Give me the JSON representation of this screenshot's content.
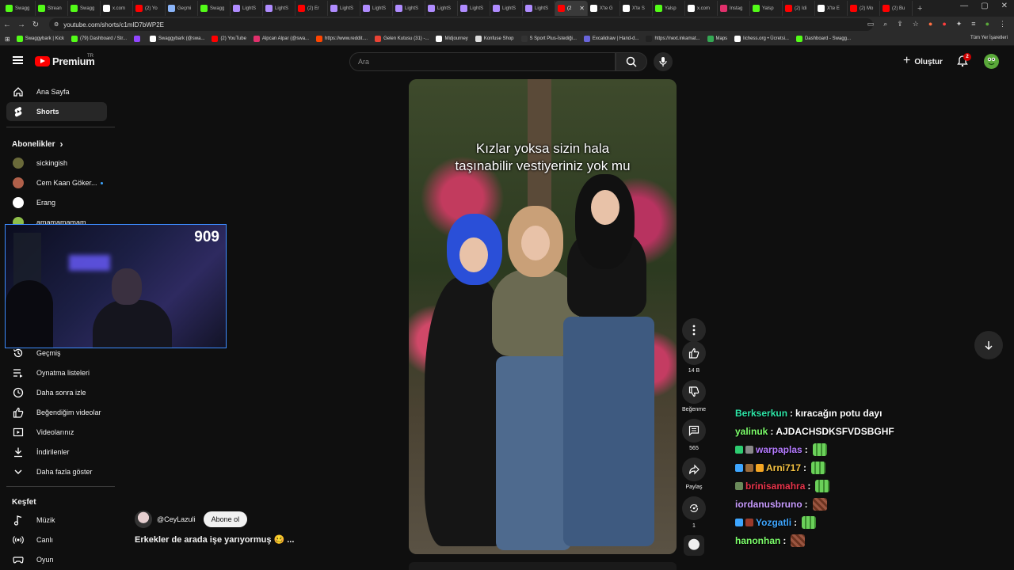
{
  "browser": {
    "tabs": [
      {
        "label": "Swagg",
        "color": "#53fc18"
      },
      {
        "label": "Strean",
        "color": "#53fc18"
      },
      {
        "label": "Swagg",
        "color": "#53fc18"
      },
      {
        "label": "x.com",
        "color": "#ffffff"
      },
      {
        "label": "(2) Yo",
        "color": "#ff0000"
      },
      {
        "label": "Geçmi",
        "color": "#8ab4f8"
      },
      {
        "label": "Swagg",
        "color": "#53fc18"
      },
      {
        "label": "LightS",
        "color": "#b08cff"
      },
      {
        "label": "LightS",
        "color": "#b08cff"
      },
      {
        "label": "(2) Er",
        "color": "#ff0000"
      },
      {
        "label": "LightS",
        "color": "#b08cff"
      },
      {
        "label": "LightS",
        "color": "#b08cff"
      },
      {
        "label": "LightS",
        "color": "#b08cff"
      },
      {
        "label": "LightS",
        "color": "#b08cff"
      },
      {
        "label": "LightS",
        "color": "#b08cff"
      },
      {
        "label": "LightS",
        "color": "#b08cff"
      },
      {
        "label": "LightS",
        "color": "#b08cff"
      },
      {
        "label": "(2",
        "color": "#ff0000",
        "active": true
      },
      {
        "label": "X'te G",
        "color": "#ffffff"
      },
      {
        "label": "X'te S",
        "color": "#ffffff"
      },
      {
        "label": "Yalsp",
        "color": "#53fc18"
      },
      {
        "label": "x.com",
        "color": "#ffffff"
      },
      {
        "label": "Instag",
        "color": "#e1306c"
      },
      {
        "label": "Yalsp",
        "color": "#53fc18"
      },
      {
        "label": "(2) Idi",
        "color": "#ff0000"
      },
      {
        "label": "X'te E",
        "color": "#ffffff"
      },
      {
        "label": "(2) Mo",
        "color": "#ff0000"
      },
      {
        "label": "(2) Bu",
        "color": "#ff0000"
      }
    ],
    "url": "youtube.com/shorts/c1mID7bWP2E",
    "bookmarks": [
      {
        "label": "Swaggybark | Kick",
        "color": "#53fc18"
      },
      {
        "label": "(79) Dashboard / Str...",
        "color": "#53fc18"
      },
      {
        "label": "",
        "color": "#9146ff"
      },
      {
        "label": "Swaggybark (@swa...",
        "color": "#ffffff"
      },
      {
        "label": "(2) YouTube",
        "color": "#ff0000"
      },
      {
        "label": "Alpcan Alpar (@swa...",
        "color": "#e1306c"
      },
      {
        "label": "https://www.reddit....",
        "color": "#ff4500"
      },
      {
        "label": "Gelen Kutusu (31) -...",
        "color": "#ea4335"
      },
      {
        "label": "Midjourney",
        "color": "#ffffff"
      },
      {
        "label": "Konfuse Shop",
        "color": "#dddddd"
      },
      {
        "label": "S Sport Plus-İstediği...",
        "color": "#333333"
      },
      {
        "label": "Excalidraw | Hand-d...",
        "color": "#6965db"
      },
      {
        "label": "https://next.inkamat...",
        "color": "#222222"
      },
      {
        "label": "Maps",
        "color": "#34a853"
      },
      {
        "label": "lichess.org • Ücretsi...",
        "color": "#ffffff"
      },
      {
        "label": "Dashboard - Swagg...",
        "color": "#53fc18"
      }
    ],
    "bookmarks_right": "Tüm Yer İşaretleri"
  },
  "header": {
    "logo_text": "Premium",
    "region": "TR",
    "search_placeholder": "Ara",
    "create_label": "Oluştur",
    "notification_count": "2"
  },
  "sidebar": {
    "main": [
      {
        "label": "Ana Sayfa",
        "icon": "home-icon"
      },
      {
        "label": "Shorts",
        "icon": "shorts-icon",
        "active": true
      }
    ],
    "subscriptions_heading": "Abonelikler",
    "channels": [
      {
        "label": "sickingish",
        "color": "#6a6a3a"
      },
      {
        "label": "Cem Kaan Göker...",
        "color": "#b0604a",
        "new": true
      },
      {
        "label": "Erang",
        "color": "#ffffff"
      },
      {
        "label": "amamamamam",
        "color": "#8fbf4a"
      }
    ],
    "you_items": [
      {
        "label": "Geçmiş",
        "icon": "history-icon"
      },
      {
        "label": "Oynatma listeleri",
        "icon": "playlist-icon"
      },
      {
        "label": "Daha sonra izle",
        "icon": "clock-icon"
      },
      {
        "label": "Beğendiğim videolar",
        "icon": "like-icon"
      },
      {
        "label": "Videolarınız",
        "icon": "video-icon"
      },
      {
        "label": "İndirilenler",
        "icon": "download-icon"
      },
      {
        "label": "Daha fazla göster",
        "icon": "chevron-down-icon"
      }
    ],
    "explore_heading": "Keşfet",
    "explore": [
      {
        "label": "Müzik",
        "icon": "music-icon"
      },
      {
        "label": "Canlı",
        "icon": "live-icon"
      },
      {
        "label": "Oyun",
        "icon": "game-icon"
      }
    ]
  },
  "webcam": {
    "viewer_count": "909"
  },
  "short": {
    "caption_line1": "Kızlar yoksa sizin hala",
    "caption_line2": "taşınabilir vestiyeriniz yok mu",
    "channel": "@CeyLazuli",
    "subscribe_label": "Abone ol",
    "title": "Erkekler de arada işe yarıyormuş 🥴 ...",
    "like_count": "14 B",
    "dislike_label": "Beğenme",
    "comment_count": "565",
    "share_label": "Paylaş",
    "remix_count": "1"
  },
  "chat": [
    {
      "user": "Berkserkun",
      "color": "#2ee6a8",
      "message": "kıracağın potu dayı",
      "badges": [],
      "emotes": []
    },
    {
      "user": "yalinuk",
      "color": "#7dff6b",
      "message": "AJDACHSDKSFVDSBGHF",
      "badges": [],
      "emotes": []
    },
    {
      "user": "warpaplas",
      "color": "#b57bff",
      "message": "",
      "badges": [
        "#2ecc71",
        "#888888"
      ],
      "emotes": [
        "green"
      ]
    },
    {
      "user": "Arni717",
      "color": "#f5c242",
      "message": "",
      "badges": [
        "#3ea6ff",
        "#9a6b3a",
        "#f5a623"
      ],
      "emotes": [
        "green"
      ]
    },
    {
      "user": "brinisamahra",
      "color": "#e8344a",
      "message": "",
      "badges": [
        "#6a8a5a"
      ],
      "emotes": [
        "green"
      ]
    },
    {
      "user": "iordanusbruno",
      "color": "#c89bff",
      "message": "",
      "badges": [],
      "emotes": [
        "brown"
      ]
    },
    {
      "user": "Yozgatli",
      "color": "#3ea6ff",
      "message": "",
      "badges": [
        "#3ea6ff",
        "#9a3a2a"
      ],
      "emotes": [
        "green"
      ]
    },
    {
      "user": "hanonhan",
      "color": "#7dff6b",
      "message": "",
      "badges": [],
      "emotes": [
        "brown"
      ]
    }
  ]
}
